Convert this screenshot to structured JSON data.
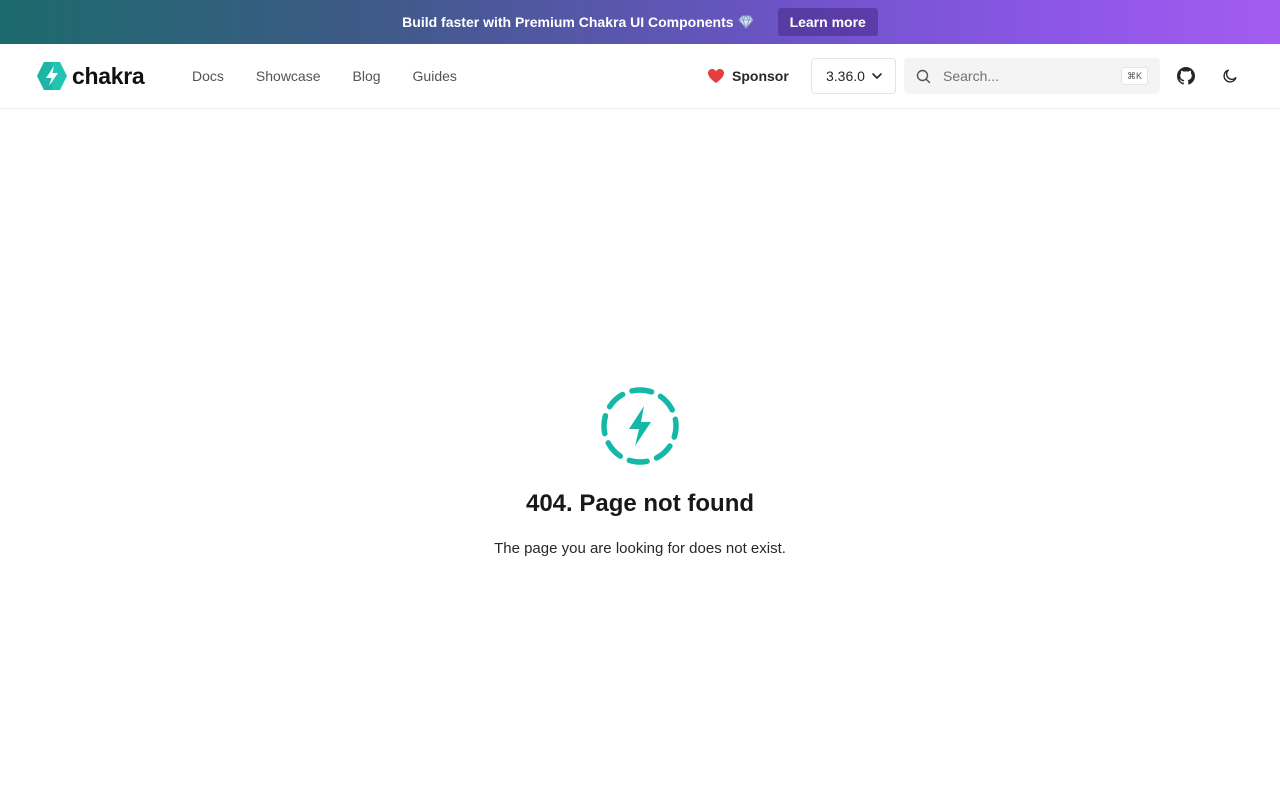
{
  "banner": {
    "text": "Build faster with Premium Chakra UI Components",
    "gem_icon": "gem-icon",
    "cta_label": "Learn more"
  },
  "header": {
    "logo_text": "chakra",
    "nav": [
      {
        "label": "Docs"
      },
      {
        "label": "Showcase"
      },
      {
        "label": "Blog"
      },
      {
        "label": "Guides"
      }
    ],
    "sponsor_label": "Sponsor",
    "version_label": "3.36.0",
    "search": {
      "placeholder": "Search...",
      "shortcut": "⌘K"
    },
    "icons": [
      "github-icon",
      "moon-icon"
    ]
  },
  "main": {
    "title": "404. Page not found",
    "message": "The page you are looking for does not exist."
  },
  "colors": {
    "brand": "#14b8a6",
    "heart": "#e53e3e"
  }
}
